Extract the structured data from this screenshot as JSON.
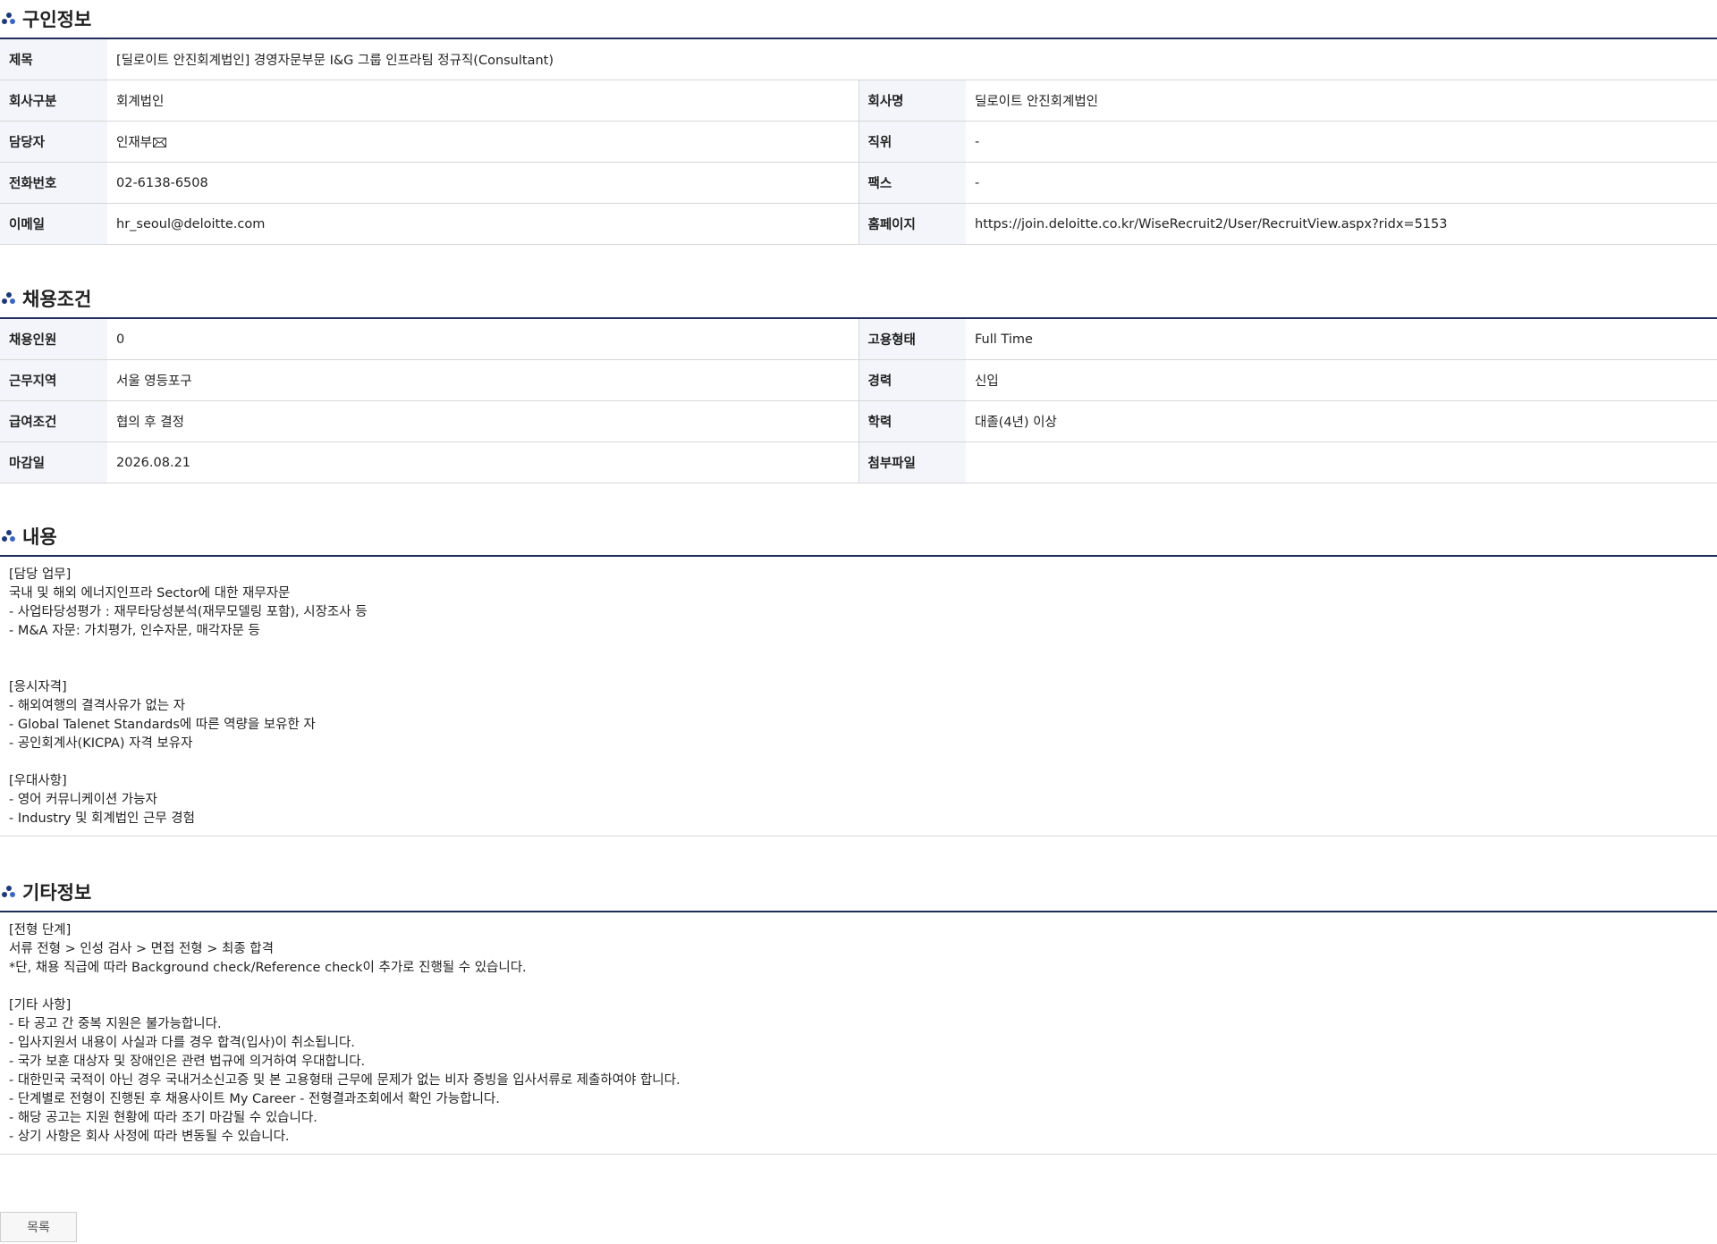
{
  "recruit_info": {
    "title": "구인정보",
    "rows": [
      {
        "label": "제목",
        "value": "[딜로이트 안진회계법인] 경영자문부문 I&G 그룹 인프라팀 정규직(Consultant)"
      },
      {
        "label": "회사구분",
        "value": "회계법인",
        "label2": "회사명",
        "value2": "딜로이트 안진회계법인"
      },
      {
        "label": "담당자",
        "value": "인재부",
        "label2": "직위",
        "value2": "-"
      },
      {
        "label": "전화번호",
        "value": "02-6138-6508",
        "label2": "팩스",
        "value2": "-"
      },
      {
        "label": "이메일",
        "value": "hr_seoul@deloitte.com",
        "label2": "홈페이지",
        "value2": "https://join.deloitte.co.kr/WiseRecruit2/User/RecruitView.aspx?ridx=5153"
      }
    ]
  },
  "conditions": {
    "title": "채용조건",
    "rows": [
      {
        "label": "채용인원",
        "value": "0",
        "label2": "고용형태",
        "value2": "Full Time"
      },
      {
        "label": "근무지역",
        "value": "서울 영등포구",
        "label2": "경력",
        "value2": "신입"
      },
      {
        "label": "급여조건",
        "value": "협의 후 결정",
        "label2": "학력",
        "value2": "대졸(4년) 이상"
      },
      {
        "label": "마감일",
        "value": "2026.08.21",
        "label2": "첨부파일",
        "value2": ""
      }
    ]
  },
  "content": {
    "title": "내용",
    "lines": [
      "[담당 업무]",
      "국내 및 해외 에너지인프라 Sector에 대한 재무자문",
      "- 사업타당성평가 : 재무타당성분석(재무모델링 포함), 시장조사 등",
      "- M&A 자문: 가치평가, 인수자문, 매각자문 등",
      "",
      "",
      "[응시자격]",
      "- 해외여행의 결격사유가 없는 자",
      "- Global Talenet Standards에 따른 역량을 보유한 자",
      "- 공인회계사(KICPA) 자격 보유자",
      "",
      "[우대사항]",
      "- 영어 커뮤니케이션 가능자",
      "- Industry 및 회계법인 근무 경험"
    ]
  },
  "etc": {
    "title": "기타정보",
    "lines": [
      "[전형 단계]",
      "서류 전형 > 인성 검사 > 면접 전형 > 최종 합격",
      "*단, 채용 직급에 따라 Background check/Reference check이 추가로 진행될 수 있습니다.",
      "",
      "[기타 사항]",
      "- 타 공고 간 중복 지원은 불가능합니다.",
      "- 입사지원서 내용이 사실과 다를 경우 합격(입사)이 취소됩니다.",
      "- 국가 보훈 대상자 및 장애인은 관련 법규에 의거하여 우대합니다.",
      "- 대한민국 국적이 아닌 경우 국내거소신고증 및 본 고용형태 근무에 문제가 없는 비자 증빙을 입사서류로 제출하여야 합니다.",
      "- 단계별로 전형이 진행된 후 채용사이트 My Career - 전형결과조회에서 확인 가능합니다.",
      "- 해당 공고는 지원 현황에 따라 조기 마감될 수 있습니다.",
      "- 상기 사항은 회사 사정에 따라 변동될 수 있습니다."
    ]
  },
  "list_button_label": "목록",
  "icons": {
    "section": "dots-bullet-icon",
    "mail": "mail-icon"
  },
  "colors": {
    "section_line": "#1f2d5a",
    "label_bg": "#f4f5fa",
    "border": "#d7d7d7"
  }
}
